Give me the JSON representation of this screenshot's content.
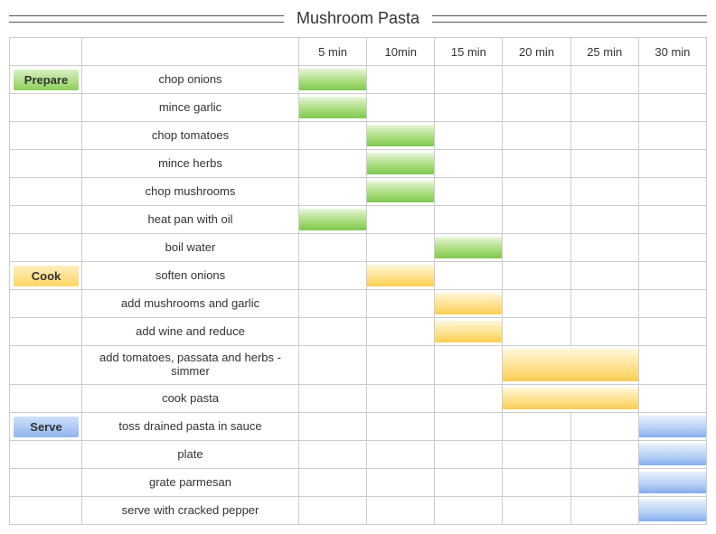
{
  "title": "Mushroom Pasta",
  "time_headers": [
    "5 min",
    "10min",
    "15 min",
    "20 min",
    "25 min",
    "30 min"
  ],
  "sections": {
    "prepare": {
      "label": "Prepare",
      "color": "green"
    },
    "cook": {
      "label": "Cook",
      "color": "yellow"
    },
    "serve": {
      "label": "Serve",
      "color": "blue"
    }
  },
  "rows": [
    {
      "section": "prepare",
      "desc": "chop onions",
      "color": "green",
      "start": 1,
      "span": 1
    },
    {
      "section": null,
      "desc": "mince garlic",
      "color": "green",
      "start": 1,
      "span": 1
    },
    {
      "section": null,
      "desc": "chop tomatoes",
      "color": "green",
      "start": 2,
      "span": 1
    },
    {
      "section": null,
      "desc": "mince herbs",
      "color": "green",
      "start": 2,
      "span": 1
    },
    {
      "section": null,
      "desc": "chop mushrooms",
      "color": "green",
      "start": 2,
      "span": 1
    },
    {
      "section": null,
      "desc": "heat pan with oil",
      "color": "green",
      "start": 1,
      "span": 1
    },
    {
      "section": null,
      "desc": "boil water",
      "color": "green",
      "start": 3,
      "span": 1
    },
    {
      "section": "cook",
      "desc": "soften onions",
      "color": "yellow",
      "start": 2,
      "span": 1
    },
    {
      "section": null,
      "desc": "add mushrooms and garlic",
      "color": "yellow",
      "start": 3,
      "span": 1
    },
    {
      "section": null,
      "desc": "add wine and reduce",
      "color": "yellow",
      "start": 3,
      "span": 1
    },
    {
      "section": null,
      "desc": "add tomatoes, passata and herbs - simmer",
      "color": "yellow",
      "start": 4,
      "span": 2,
      "tall": true
    },
    {
      "section": null,
      "desc": "cook pasta",
      "color": "yellow",
      "start": 4,
      "span": 2
    },
    {
      "section": "serve",
      "desc": "toss drained pasta in sauce",
      "color": "blue",
      "start": 6,
      "span": 1
    },
    {
      "section": null,
      "desc": "plate",
      "color": "blue",
      "start": 6,
      "span": 1
    },
    {
      "section": null,
      "desc": "grate parmesan",
      "color": "blue",
      "start": 6,
      "span": 1
    },
    {
      "section": null,
      "desc": "serve with cracked pepper",
      "color": "blue",
      "start": 6,
      "span": 1
    }
  ],
  "chart_data": {
    "type": "bar",
    "orientation": "gantt",
    "title": "Mushroom Pasta",
    "xlabel": "minutes",
    "x_ticks": [
      5,
      10,
      15,
      20,
      25,
      30
    ],
    "xlim": [
      0,
      30
    ],
    "series": [
      {
        "name": "Prepare",
        "color": "#8ecf5a",
        "tasks": [
          {
            "label": "chop onions",
            "start": 0,
            "end": 5
          },
          {
            "label": "mince garlic",
            "start": 0,
            "end": 5
          },
          {
            "label": "chop tomatoes",
            "start": 5,
            "end": 10
          },
          {
            "label": "mince herbs",
            "start": 5,
            "end": 10
          },
          {
            "label": "chop mushrooms",
            "start": 5,
            "end": 10
          },
          {
            "label": "heat pan with oil",
            "start": 0,
            "end": 5
          },
          {
            "label": "boil water",
            "start": 10,
            "end": 15
          }
        ]
      },
      {
        "name": "Cook",
        "color": "#f9cd51",
        "tasks": [
          {
            "label": "soften onions",
            "start": 5,
            "end": 10
          },
          {
            "label": "add mushrooms and garlic",
            "start": 10,
            "end": 15
          },
          {
            "label": "add wine and reduce",
            "start": 10,
            "end": 15
          },
          {
            "label": "add tomatoes, passata and herbs - simmer",
            "start": 15,
            "end": 25
          },
          {
            "label": "cook pasta",
            "start": 15,
            "end": 25
          }
        ]
      },
      {
        "name": "Serve",
        "color": "#84adec",
        "tasks": [
          {
            "label": "toss drained pasta in sauce",
            "start": 25,
            "end": 30
          },
          {
            "label": "plate",
            "start": 25,
            "end": 30
          },
          {
            "label": "grate parmesan",
            "start": 25,
            "end": 30
          },
          {
            "label": "serve with cracked pepper",
            "start": 25,
            "end": 30
          }
        ]
      }
    ]
  }
}
